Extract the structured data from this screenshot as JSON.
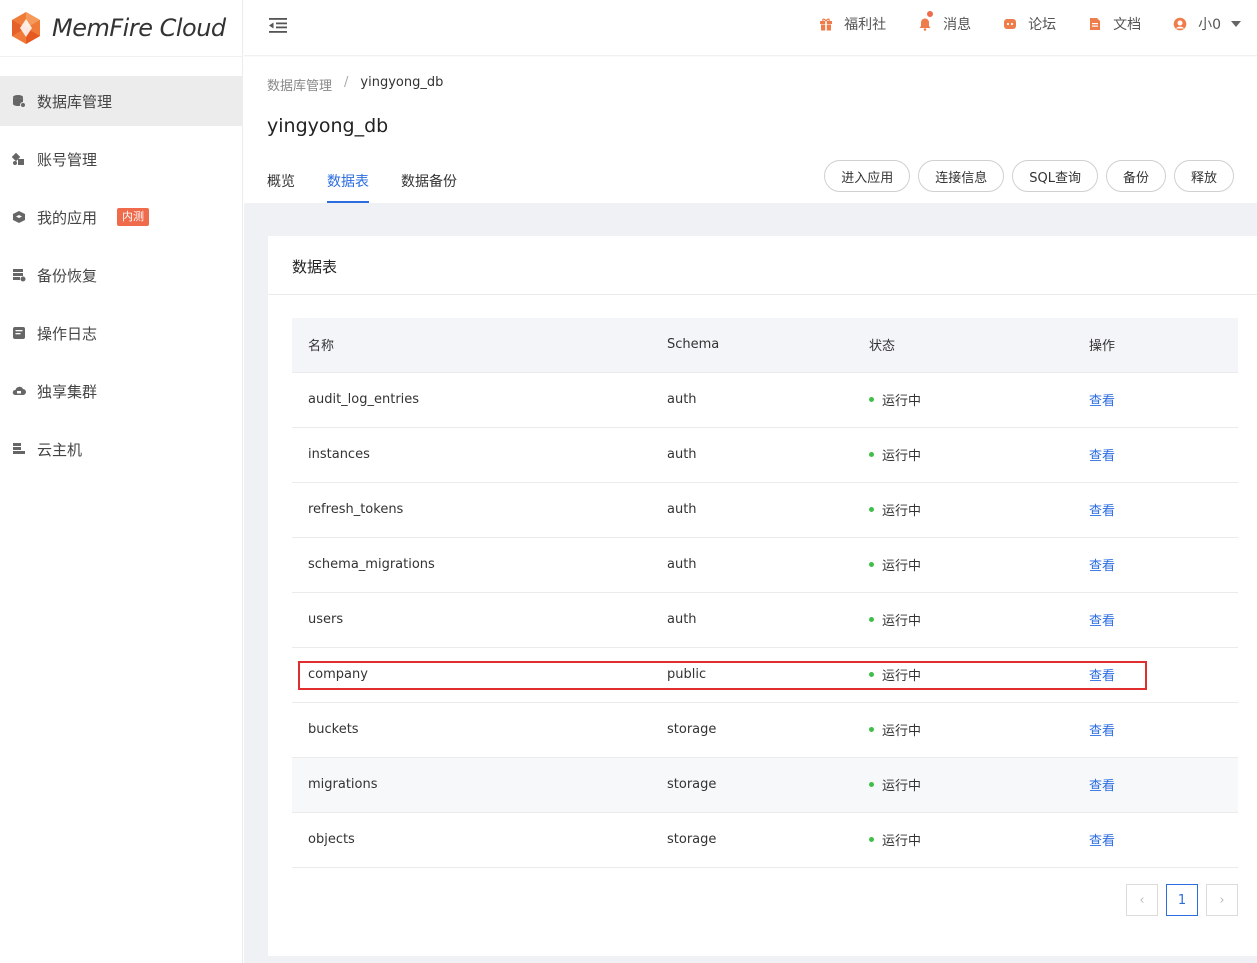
{
  "app": {
    "logo_text": "MemFire Cloud"
  },
  "sidebar": {
    "items": [
      {
        "label": "数据库管理",
        "icon": "database-icon"
      },
      {
        "label": "账号管理",
        "icon": "account-icon"
      },
      {
        "label": "我的应用",
        "icon": "cube-icon",
        "badge": "内测"
      },
      {
        "label": "备份恢复",
        "icon": "backup-icon"
      },
      {
        "label": "操作日志",
        "icon": "log-icon"
      },
      {
        "label": "独享集群",
        "icon": "cloud-icon"
      },
      {
        "label": "云主机",
        "icon": "server-icon"
      }
    ]
  },
  "topbar": {
    "welfare": "福利社",
    "messages": "消息",
    "forum": "论坛",
    "docs": "文档",
    "user": "小0"
  },
  "header": {
    "breadcrumb": [
      "数据库管理",
      "yingyong_db"
    ],
    "title": "yingyong_db",
    "tabs": [
      "概览",
      "数据表",
      "数据备份"
    ],
    "actions": [
      "进入应用",
      "连接信息",
      "SQL查询",
      "备份",
      "释放"
    ]
  },
  "card": {
    "title": "数据表",
    "columns": [
      "名称",
      "Schema",
      "状态",
      "操作"
    ],
    "rows": [
      {
        "name": "audit_log_entries",
        "schema": "auth",
        "status": "运行中",
        "action": "查看"
      },
      {
        "name": "instances",
        "schema": "auth",
        "status": "运行中",
        "action": "查看"
      },
      {
        "name": "refresh_tokens",
        "schema": "auth",
        "status": "运行中",
        "action": "查看"
      },
      {
        "name": "schema_migrations",
        "schema": "auth",
        "status": "运行中",
        "action": "查看"
      },
      {
        "name": "users",
        "schema": "auth",
        "status": "运行中",
        "action": "查看"
      },
      {
        "name": "company",
        "schema": "public",
        "status": "运行中",
        "action": "查看"
      },
      {
        "name": "buckets",
        "schema": "storage",
        "status": "运行中",
        "action": "查看"
      },
      {
        "name": "migrations",
        "schema": "storage",
        "status": "运行中",
        "action": "查看"
      },
      {
        "name": "objects",
        "schema": "storage",
        "status": "运行中",
        "action": "查看"
      }
    ],
    "pagination": {
      "prev": "‹",
      "current": "1",
      "next": "›"
    }
  },
  "colors": {
    "accent": "#2b6de0",
    "status_running": "#3fbf4a",
    "badge": "#ef6b4c",
    "highlight": "#e02e2e"
  }
}
